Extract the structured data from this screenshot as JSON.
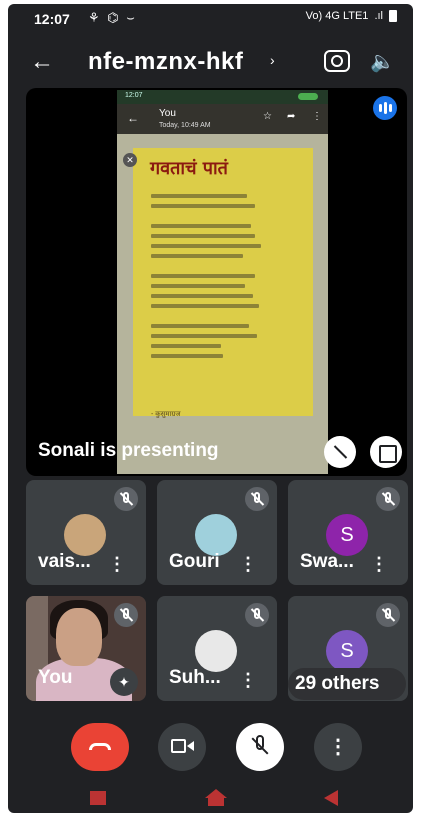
{
  "status": {
    "time": "12:07",
    "icons_left": "⚘ ⌬ ⌣",
    "network": "Vo) 4G LTE1",
    "signal": ".ıl"
  },
  "header": {
    "meeting_code": "nfe-mznx-hkf",
    "chevron": "›",
    "back": "←",
    "speaker": "🔈"
  },
  "presentation": {
    "presenter_text": "Sonali is presenting",
    "shared_screen": {
      "status_time": "12:07",
      "sender": "You",
      "date": "Today, 10:49 AM",
      "poem_title": "गवताचं पातं",
      "signature": "- कुसुमाग्रज"
    }
  },
  "participants": [
    {
      "name": "vais...",
      "avatar": "photo",
      "muted": true
    },
    {
      "name": "Gouri",
      "avatar": "photo",
      "muted": true
    },
    {
      "name": "Swa...",
      "avatar": "initial",
      "initial": "S",
      "muted": true
    },
    {
      "name": "You",
      "avatar": "video",
      "muted": true
    },
    {
      "name": "Suh...",
      "avatar": "photo",
      "muted": true
    }
  ],
  "others_tile": {
    "initial": "S",
    "label": "29 others"
  },
  "controls": {
    "more": "⋮",
    "kebab": "⋮",
    "effects": "✦"
  }
}
